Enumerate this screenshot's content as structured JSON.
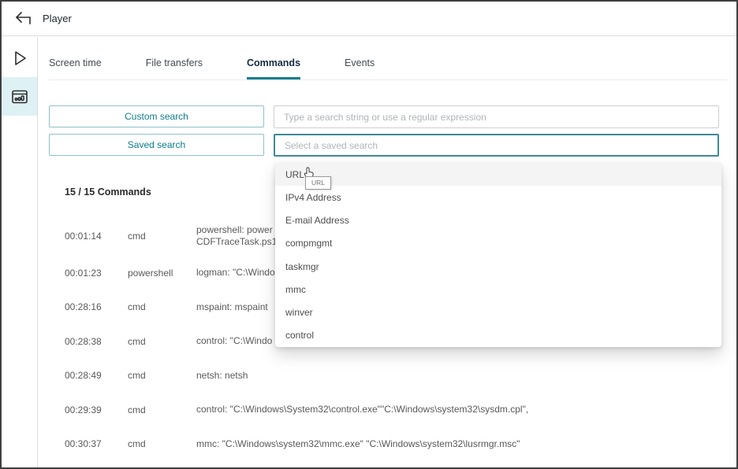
{
  "window": {
    "title": "Player"
  },
  "sidebar": {
    "items": [
      {
        "icon": "play-icon",
        "active": false
      },
      {
        "icon": "activity-stats-icon",
        "active": true
      }
    ]
  },
  "tabs": [
    {
      "label": "Screen time",
      "active": false
    },
    {
      "label": "File transfers",
      "active": false
    },
    {
      "label": "Commands",
      "active": true
    },
    {
      "label": "Events",
      "active": false
    }
  ],
  "search": {
    "custom_label": "Custom search",
    "saved_label": "Saved search",
    "search_placeholder": "Type a search string or use a regular expression",
    "saved_placeholder": "Select a saved search"
  },
  "dropdown": {
    "tooltip": "URL",
    "items": [
      {
        "label": "URL",
        "hover": true
      },
      {
        "label": "IPv4 Address"
      },
      {
        "label": "E-mail Address"
      },
      {
        "label": "compmgmt"
      },
      {
        "label": "taskmgr"
      },
      {
        "label": "mmc"
      },
      {
        "label": "winver"
      },
      {
        "label": "control"
      }
    ]
  },
  "commands": {
    "summary": "15 / 15 Commands",
    "rows": [
      {
        "time": "00:01:14",
        "process": "cmd",
        "command": "powershell: power\nCDFTraceTask.ps1",
        "tall": true
      },
      {
        "time": "00:01:23",
        "process": "powershell",
        "command": "logman: \"C:\\Windo"
      },
      {
        "time": "00:28:16",
        "process": "cmd",
        "command": "mspaint: mspaint"
      },
      {
        "time": "00:28:38",
        "process": "cmd",
        "command": "control: \"C:\\Windo"
      },
      {
        "time": "00:28:49",
        "process": "cmd",
        "command": "netsh: netsh"
      },
      {
        "time": "00:29:39",
        "process": "cmd",
        "command": "control: \"C:\\Windows\\System32\\control.exe\"\"C:\\Windows\\system32\\sysdm.cpl\","
      },
      {
        "time": "00:30:37",
        "process": "cmd",
        "command": "mmc: \"C:\\Windows\\system32\\mmc.exe\" \"C:\\Windows\\system32\\lusrmgr.msc\""
      }
    ]
  },
  "colors": {
    "accent_teal": "#0e7e8f",
    "button_border": "#8fc1cb",
    "button_text": "#0b7d8a",
    "active_tab_text": "#152b45",
    "sidebar_highlight": "#def1f5",
    "focused_input_border": "#3e8a96",
    "row_text": "#595959"
  }
}
